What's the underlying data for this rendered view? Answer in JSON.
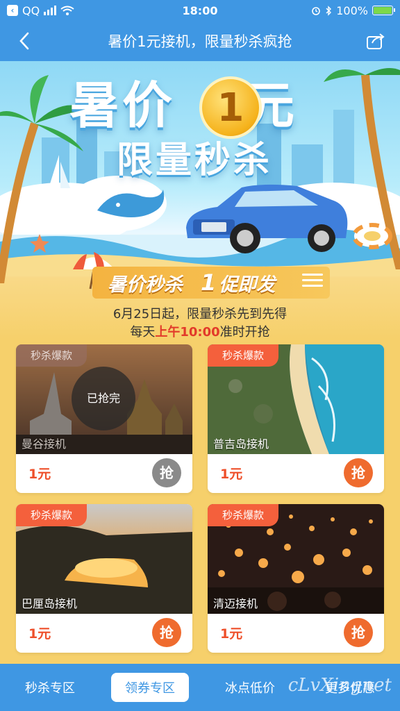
{
  "status_bar": {
    "app_name": "QQ",
    "time": "18:00",
    "battery": "100%"
  },
  "nav": {
    "title": "暑价1元接机，限量秒杀疯抢",
    "back_icon": "chevron-left-icon",
    "share_icon": "share-icon"
  },
  "banner": {
    "title_part1": "暑价",
    "coin_text": "1",
    "title_part2": "元",
    "subtitle": "限量秒杀",
    "ribbon_left": "暑价秒杀",
    "ribbon_num": "1",
    "ribbon_right": "促即发",
    "info_line1": "6月25日起，限量秒杀先到先得",
    "info_line2_prefix": "每天",
    "info_line2_highlight": "上午10:00",
    "info_line2_suffix": "准时开抢"
  },
  "products": [
    {
      "tag": "秒杀爆款",
      "name": "曼谷接机",
      "price": "1元",
      "button": "抢",
      "status": "已抢完",
      "sold_out": true
    },
    {
      "tag": "秒杀爆款",
      "name": "普吉岛接机",
      "price": "1元",
      "button": "抢",
      "sold_out": false
    },
    {
      "tag": "秒杀爆款",
      "name": "巴厘岛接机",
      "price": "1元",
      "button": "抢",
      "sold_out": false
    },
    {
      "tag": "秒杀爆款",
      "name": "清迈接机",
      "price": "1元",
      "button": "抢",
      "sold_out": false
    }
  ],
  "bottom_tabs": [
    {
      "label": "秒杀专区",
      "active": false
    },
    {
      "label": "领券专区",
      "active": true
    },
    {
      "label": "冰点低价",
      "active": false
    },
    {
      "label": "更多优惠",
      "active": false
    }
  ],
  "watermark": "cLvXingnet",
  "colors": {
    "header_blue": "#3f97e3",
    "accent_orange": "#ef6b2e",
    "tag_red": "#f4603c",
    "price_red": "#ee4f2a",
    "page_yellow": "#f6d06b"
  }
}
